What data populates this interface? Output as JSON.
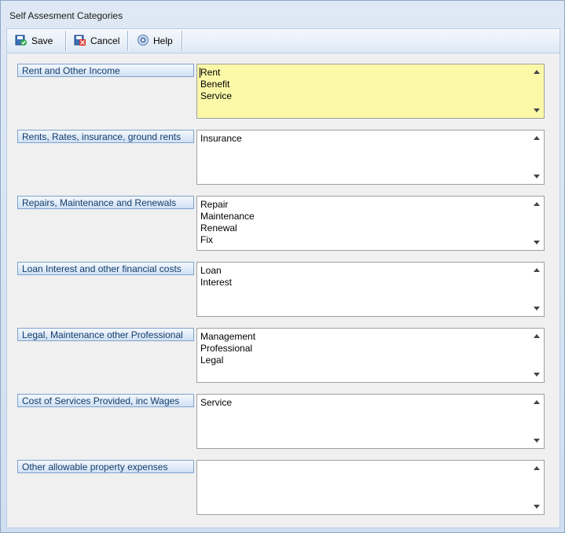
{
  "window": {
    "title": "Self Assesment Categories"
  },
  "toolbar": {
    "save_label": "Save",
    "cancel_label": "Cancel",
    "help_label": "Help"
  },
  "categories": [
    {
      "label": "Rent and Other Income",
      "items": [
        "Rent",
        "Benefit",
        "Service"
      ],
      "focused": true
    },
    {
      "label": "Rents, Rates, insurance, ground rents",
      "items": [
        "Insurance"
      ]
    },
    {
      "label": "Repairs, Maintenance and Renewals",
      "items": [
        "Repair",
        "Maintenance",
        "Renewal",
        "Fix"
      ]
    },
    {
      "label": "Loan Interest and other financial costs",
      "items": [
        "Loan",
        "Interest"
      ]
    },
    {
      "label": "Legal, Maintenance other Professional",
      "items": [
        "Management",
        "Professional",
        "Legal"
      ]
    },
    {
      "label": "Cost of Services Provided, inc Wages",
      "items": [
        "Service"
      ]
    },
    {
      "label": "Other allowable property expenses",
      "items": []
    }
  ],
  "colors": {
    "focused_listbox": "#fbf9a8",
    "label_text": "#143d6b"
  },
  "icons": {
    "save": "save-check-icon",
    "cancel": "cancel-x-icon",
    "help": "help-icon"
  }
}
